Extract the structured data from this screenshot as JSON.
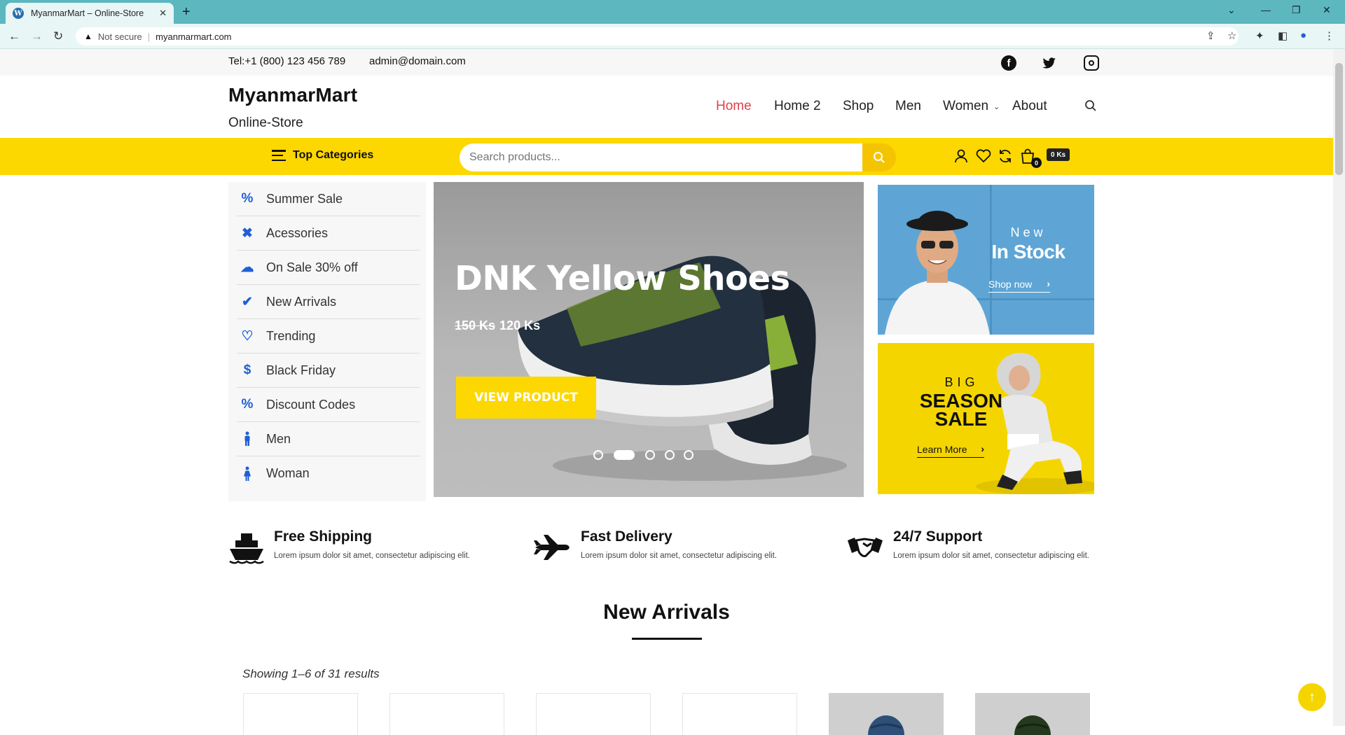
{
  "browser": {
    "tab_title": "MyanmarMart – Online-Store",
    "new_tab": "+",
    "not_secure": "Not secure",
    "url": "myanmarmart.com"
  },
  "topbar": {
    "phone": "Tel:+1 (800) 123 456 789",
    "email": "admin@domain.com",
    "social": [
      "facebook-icon",
      "twitter-icon",
      "instagram-icon"
    ]
  },
  "header": {
    "logo": "MyanmarMart",
    "tagline": "Online-Store",
    "menu": [
      {
        "label": "Home",
        "active": true
      },
      {
        "label": "Home 2",
        "active": false
      },
      {
        "label": "Shop",
        "active": false
      },
      {
        "label": "Men",
        "active": false
      },
      {
        "label": "Women",
        "active": false,
        "dropdown": true
      },
      {
        "label": "About",
        "active": false
      }
    ]
  },
  "toolbar": {
    "top_categories": "Top Categories",
    "search_placeholder": "Search products...",
    "cart_count": "0",
    "cart_total": "0 Ks"
  },
  "categories": [
    {
      "label": "Summer Sale",
      "icon": "percent-tag-icon"
    },
    {
      "label": "Acessories",
      "icon": "tools-icon"
    },
    {
      "label": "On Sale 30% off",
      "icon": "cloud-icon"
    },
    {
      "label": "New Arrivals",
      "icon": "check-icon"
    },
    {
      "label": "Trending",
      "icon": "heart-icon"
    },
    {
      "label": "Black Friday",
      "icon": "dollar-icon"
    },
    {
      "label": "Discount Codes",
      "icon": "percent-icon"
    },
    {
      "label": "Men",
      "icon": "male-icon"
    },
    {
      "label": "Woman",
      "icon": "female-icon"
    }
  ],
  "slider": {
    "title": "DNK Yellow Shoes",
    "old_price": "150 Ks",
    "new_price": "120 Ks",
    "button": "VIEW PRODUCT",
    "slide_count": 5,
    "active_slide": 2
  },
  "banners": {
    "b1_small": "New",
    "b1_big": "In Stock",
    "b1_link": "Shop now",
    "b2_small": "BIG",
    "b2_big1": "SEASON",
    "b2_big2": "SALE",
    "b2_link": "Learn More"
  },
  "features": [
    {
      "title": "Free Shipping",
      "desc": "Lorem ipsum dolor sit amet, consectetur adipiscing elit.",
      "icon": "ship-icon"
    },
    {
      "title": "Fast Delivery",
      "desc": "Lorem ipsum dolor sit amet, consectetur adipiscing elit.",
      "icon": "airplane-icon"
    },
    {
      "title": "24/7 Support",
      "desc": "Lorem ipsum dolor sit amet, consectetur adipiscing elit.",
      "icon": "handshake-icon"
    }
  ],
  "new_arrivals": {
    "title": "New Arrivals",
    "showing": "Showing 1–6 of 31 results"
  },
  "colors": {
    "accent_yellow": "#fdd700",
    "menu_active": "#e2404a",
    "category_icon": "#1e5fd6",
    "chrome": "#5db7bf"
  }
}
